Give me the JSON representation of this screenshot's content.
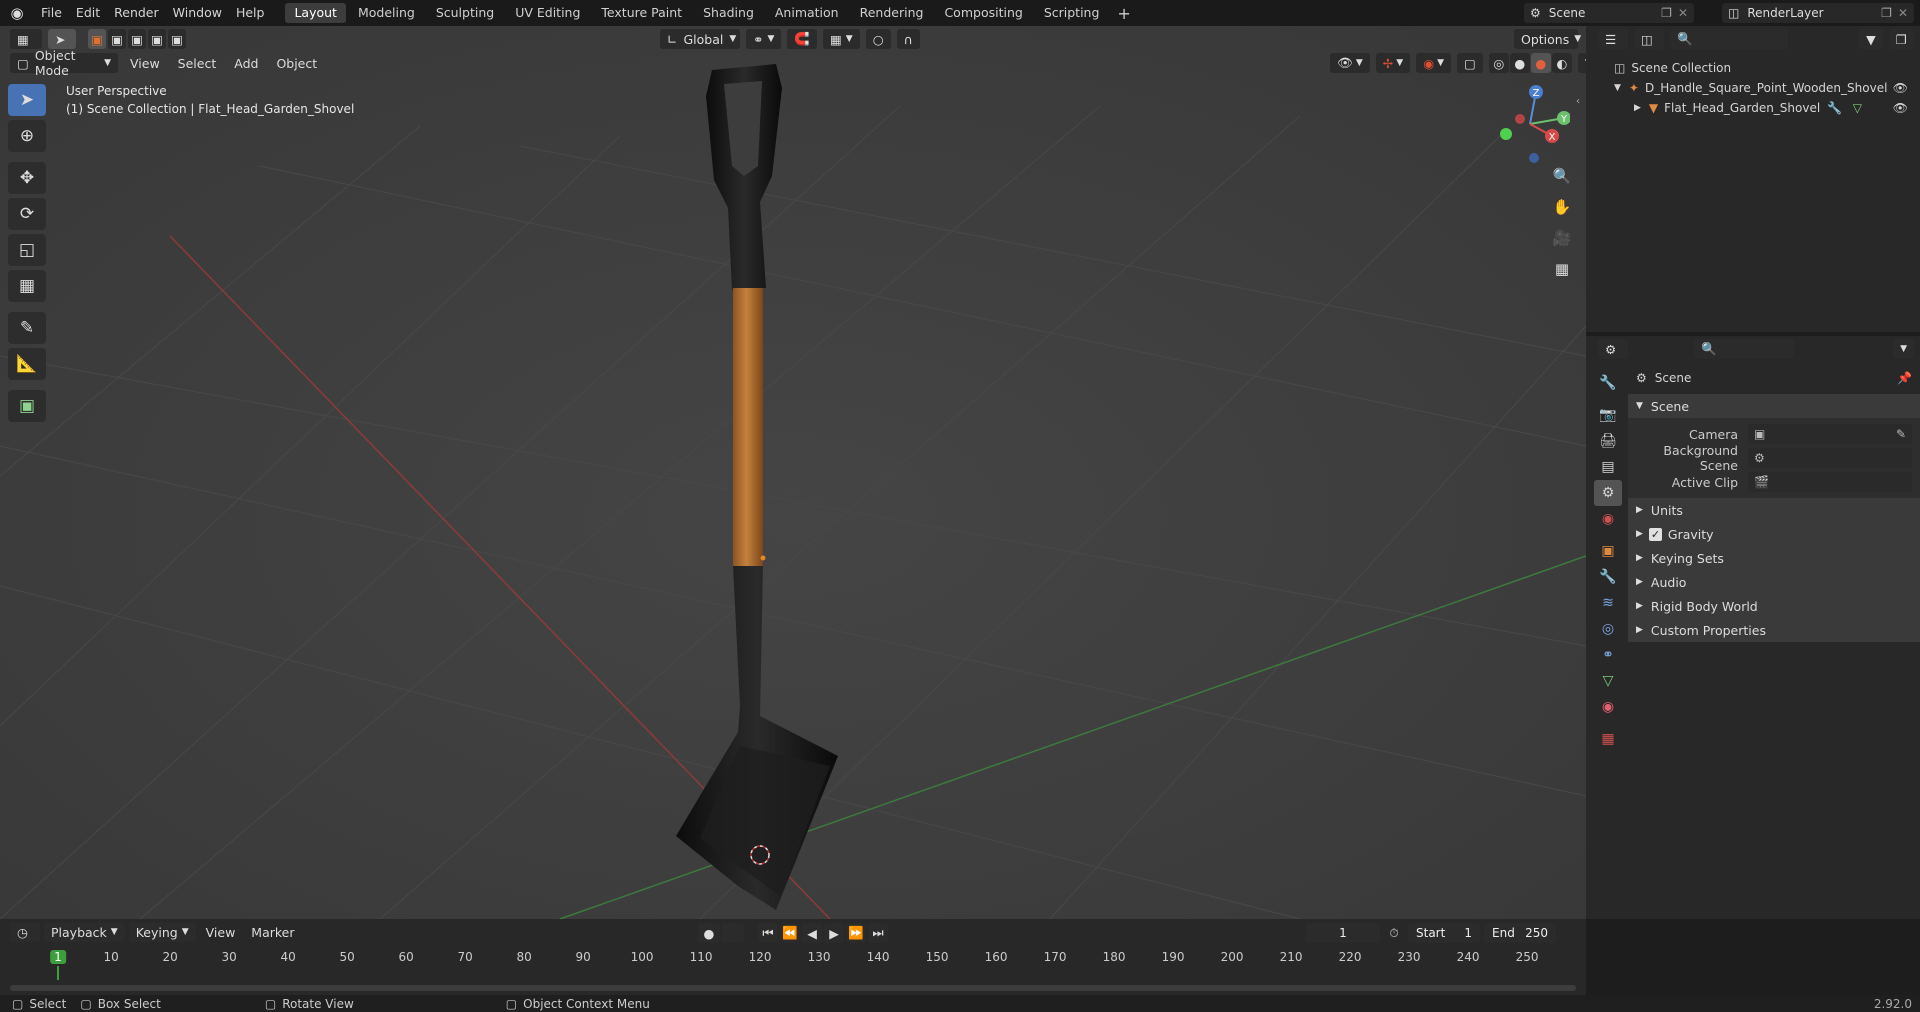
{
  "topbar": {
    "menus": [
      "File",
      "Edit",
      "Render",
      "Window",
      "Help"
    ],
    "workspaces": [
      "Layout",
      "Modeling",
      "Sculpting",
      "UV Editing",
      "Texture Paint",
      "Shading",
      "Animation",
      "Rendering",
      "Compositing",
      "Scripting"
    ],
    "active_workspace": "Layout",
    "scene_name": "Scene",
    "view_layer": "RenderLayer"
  },
  "viewport": {
    "mode": "Object Mode",
    "menus": [
      "View",
      "Select",
      "Add",
      "Object"
    ],
    "orientation": "Global",
    "options_label": "Options",
    "perspective_label": "User Perspective",
    "collection_label": "(1) Scene Collection | Flat_Head_Garden_Shovel",
    "gizmo_axes": [
      "Z",
      "Y",
      "X"
    ]
  },
  "outliner": {
    "root": "Scene Collection",
    "items": [
      {
        "label": "D_Handle_Square_Point_Wooden_Shovel"
      },
      {
        "label": "Flat_Head_Garden_Shovel"
      }
    ]
  },
  "properties": {
    "context": "Scene",
    "panel_title": "Scene",
    "fields": [
      {
        "label": "Camera",
        "value": ""
      },
      {
        "label": "Background Scene",
        "value": ""
      },
      {
        "label": "Active Clip",
        "value": ""
      }
    ],
    "subpanels": [
      {
        "label": "Units",
        "checkbox": false
      },
      {
        "label": "Gravity",
        "checkbox": true
      },
      {
        "label": "Keying Sets",
        "checkbox": false
      },
      {
        "label": "Audio",
        "checkbox": false
      },
      {
        "label": "Rigid Body World",
        "checkbox": false
      },
      {
        "label": "Custom Properties",
        "checkbox": false
      }
    ]
  },
  "timeline": {
    "menus": [
      "Playback",
      "Keying",
      "View",
      "Marker"
    ],
    "current_frame": "1",
    "start_label": "Start",
    "start_value": "1",
    "end_label": "End",
    "end_value": "250",
    "ruler_ticks": [
      "1",
      "10",
      "20",
      "30",
      "40",
      "50",
      "60",
      "70",
      "80",
      "90",
      "100",
      "110",
      "120",
      "130",
      "140",
      "150",
      "160",
      "170",
      "180",
      "190",
      "200",
      "210",
      "220",
      "230",
      "240",
      "250"
    ]
  },
  "statusbar": {
    "select": "Select",
    "box_select": "Box Select",
    "rotate_view": "Rotate View",
    "context_menu": "Object Context Menu",
    "version": "2.92.0"
  },
  "colors": {
    "accent": "#4772b3",
    "active_tab_bg": "#3d3d3d",
    "current_frame": "#3d9e3d"
  }
}
